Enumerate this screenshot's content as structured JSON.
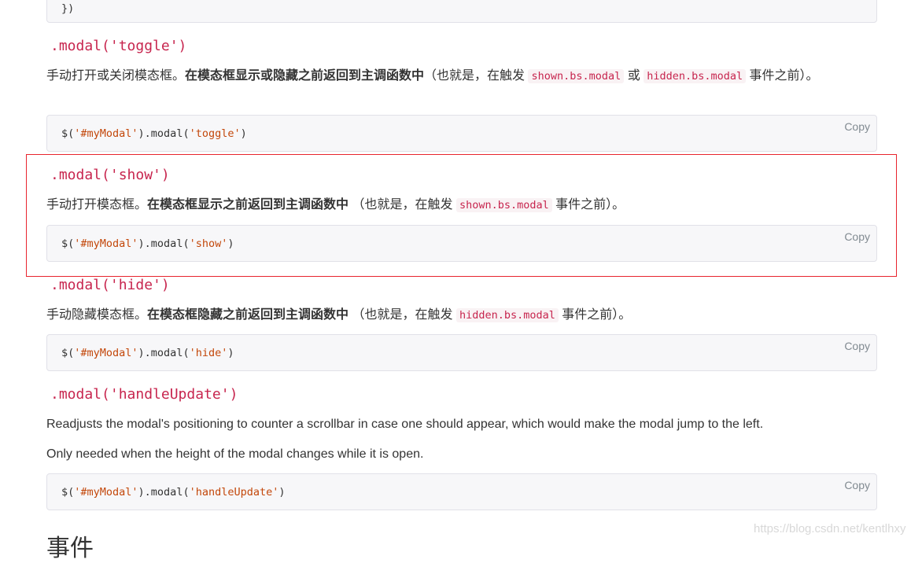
{
  "top_block": {
    "code": "})"
  },
  "sections": [
    {
      "heading": ".modal('toggle')",
      "desc_plain": "手动打开或关闭模态框。",
      "desc_bold": "在模态框显示或隐藏之前返回到主调函数中",
      "desc_mid": "（也就是，在触发 ",
      "code1": "shown.bs.modal",
      "desc_or": " 或 ",
      "code2": "hidden.bs.modal",
      "desc_end": " 事件之前）。",
      "code_prefix": "$(",
      "code_sel": "'#myModal'",
      "code_mid": ").modal(",
      "code_arg": "'toggle'",
      "code_suffix": ")",
      "copy": "Copy"
    },
    {
      "heading": ".modal('show')",
      "desc_plain": "手动打开模态框。",
      "desc_bold": "在模态框显示之前返回到主调函数中",
      "desc_mid": " （也就是，在触发 ",
      "code1": "shown.bs.modal",
      "desc_end": " 事件之前）。",
      "code_prefix": "$(",
      "code_sel": "'#myModal'",
      "code_mid": ").modal(",
      "code_arg": "'show'",
      "code_suffix": ")",
      "copy": "Copy"
    },
    {
      "heading": ".modal('hide')",
      "desc_plain": "手动隐藏模态框。",
      "desc_bold": "在模态框隐藏之前返回到主调函数中",
      "desc_mid": " （也就是，在触发 ",
      "code1": "hidden.bs.modal",
      "desc_end": " 事件之前）。",
      "code_prefix": "$(",
      "code_sel": "'#myModal'",
      "code_mid": ").modal(",
      "code_arg": "'hide'",
      "code_suffix": ")",
      "copy": "Copy"
    },
    {
      "heading": ".modal('handleUpdate')",
      "para1": "Readjusts the modal's positioning to counter a scrollbar in case one should appear, which would make the modal jump to the left.",
      "para2": "Only needed when the height of the modal changes while it is open.",
      "code_prefix": "$(",
      "code_sel": "'#myModal'",
      "code_mid": ").modal(",
      "code_arg": "'handleUpdate'",
      "code_suffix": ")",
      "copy": "Copy"
    }
  ],
  "next_heading": "事件",
  "watermark": "https://blog.csdn.net/kentlhxy",
  "highlight_color": "#e8242e"
}
